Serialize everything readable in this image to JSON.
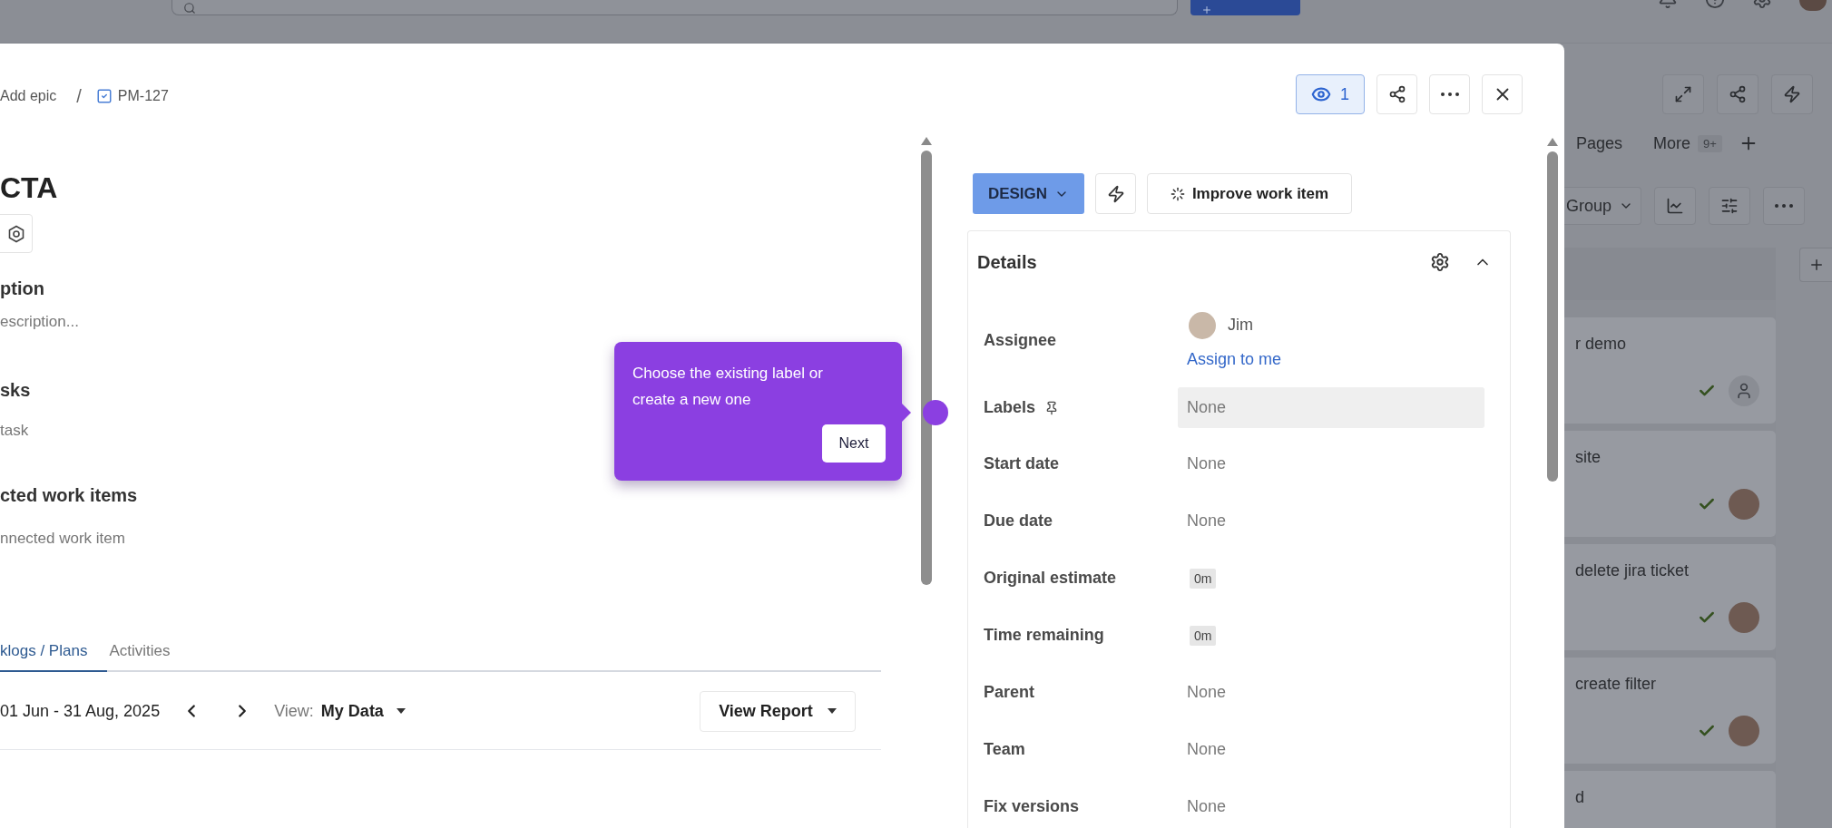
{
  "breadcrumb": [
    {
      "kind": "parent",
      "text": "Add epic"
    },
    {
      "kind": "separator",
      "text": "/"
    },
    {
      "kind": "issue",
      "text": "PM-127"
    }
  ],
  "title": "CTA",
  "sections": [
    {
      "heading": "ption",
      "hint": "escription..."
    },
    {
      "heading": "sks",
      "hint": "task"
    },
    {
      "heading": "cted work items",
      "hint": "nnected work item"
    }
  ],
  "tabs": [
    {
      "label": "klogs / Plans",
      "selected": true
    },
    {
      "label": "Activities",
      "selected": false
    }
  ],
  "worklog": {
    "range": "01 Jun - 31 Aug, 2025",
    "view_label": "View:",
    "view_value": "My Data",
    "report_button": "View Report"
  },
  "tooltip": {
    "text": "Choose the existing label or create a new one",
    "button": "Next"
  },
  "watch_button": {
    "count": "1",
    "selected": true
  },
  "status_button": "DESIGN",
  "improve_button": "Improve work item",
  "details": {
    "title": "Details",
    "expanded": true,
    "fields": [
      {
        "kind": "user",
        "label": "Assignee",
        "value": "Jim",
        "action": "Assign to me",
        "pinned": false,
        "highlighted": false
      },
      {
        "kind": "text",
        "label": "Labels",
        "value": "None",
        "pinned": true,
        "highlighted": true
      },
      {
        "kind": "text",
        "label": "Start date",
        "value": "None",
        "pinned": false,
        "highlighted": false
      },
      {
        "kind": "text",
        "label": "Due date",
        "value": "None",
        "pinned": false,
        "highlighted": false
      },
      {
        "kind": "time",
        "label": "Original estimate",
        "value": "0m",
        "pinned": false,
        "highlighted": false
      },
      {
        "kind": "time",
        "label": "Time remaining",
        "value": "0m",
        "pinned": false,
        "highlighted": false
      },
      {
        "kind": "text",
        "label": "Parent",
        "value": "None",
        "pinned": false,
        "highlighted": false
      },
      {
        "kind": "text",
        "label": "Team",
        "value": "None",
        "pinned": false,
        "highlighted": false
      },
      {
        "kind": "text",
        "label": "Fix versions",
        "value": "None",
        "pinned": false,
        "highlighted": false
      }
    ]
  },
  "board": {
    "tabs": [
      "Pages",
      "More"
    ],
    "badge": "9+",
    "group_button": "Group",
    "cards": [
      {
        "title": "r demo",
        "kind": "empty"
      },
      {
        "title": "site",
        "kind": "photo"
      },
      {
        "title": "delete jira ticket",
        "kind": "photo"
      },
      {
        "title": "create filter",
        "kind": "photo"
      },
      {
        "title": "d",
        "kind": "none"
      }
    ]
  }
}
